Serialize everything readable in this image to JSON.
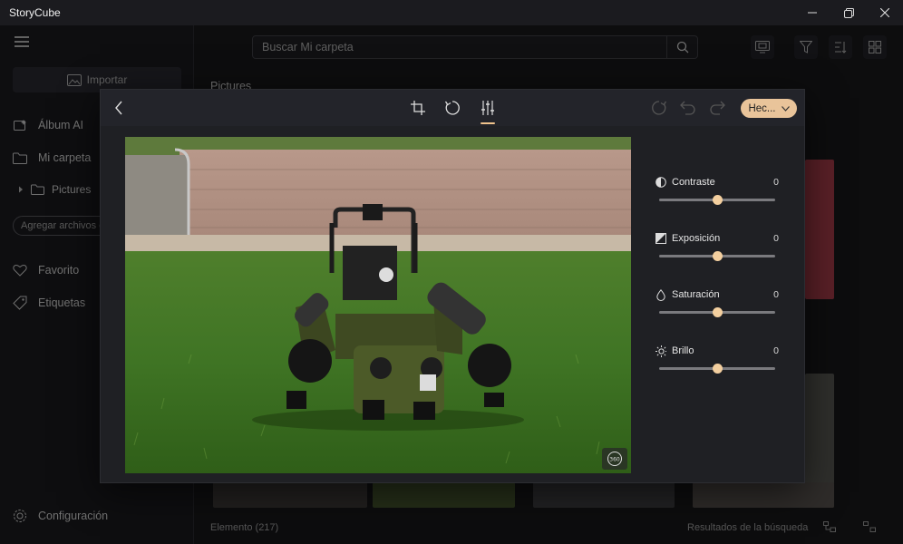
{
  "window": {
    "title": "StoryCube"
  },
  "sidebar": {
    "import_label": "Importar",
    "items": [
      {
        "label": "Álbum AI",
        "icon": "album-ai-icon"
      },
      {
        "label": "Mi carpeta",
        "icon": "folder-icon"
      },
      {
        "label": "Favorito",
        "icon": "heart-icon"
      },
      {
        "label": "Etiquetas",
        "icon": "tag-icon"
      }
    ],
    "folder_child": "Pictures",
    "add_folder_label": "Agregar archivos d",
    "settings_label": "Configuración"
  },
  "search": {
    "placeholder": "Buscar Mi carpeta"
  },
  "main": {
    "section_label": "Pictures",
    "footer_left": "Elemento (217)",
    "footer_right": "Resultados de la búsqueda"
  },
  "editor": {
    "done_label": "Hec...",
    "adjustments": [
      {
        "label": "Contraste",
        "value": "0",
        "icon": "contrast-icon",
        "level": 0.5
      },
      {
        "label": "Exposición",
        "value": "0",
        "icon": "exposure-icon",
        "level": 0.5
      },
      {
        "label": "Saturación",
        "value": "0",
        "icon": "saturation-icon",
        "level": 0.5
      },
      {
        "label": "Brillo",
        "value": "0",
        "icon": "brightness-icon",
        "level": 0.5
      }
    ]
  },
  "colors": {
    "accent": "#e9c49a",
    "slider_thumb": "#f3cf9f",
    "panel": "#1f2024"
  }
}
